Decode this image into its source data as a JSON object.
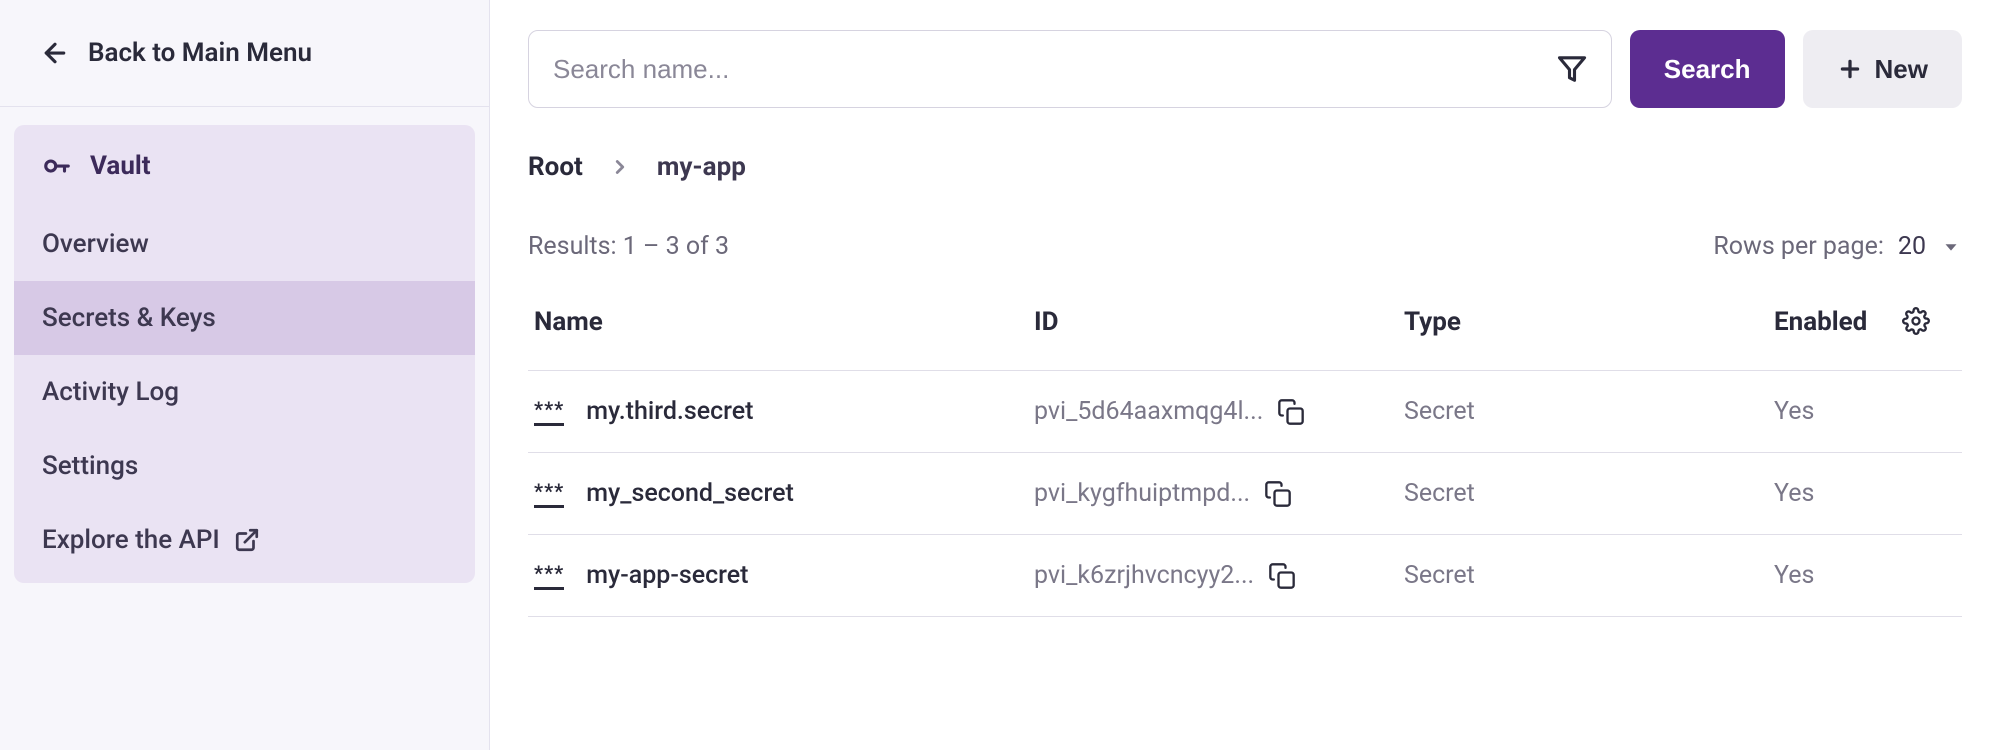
{
  "sidebar": {
    "back_label": "Back to Main Menu",
    "group_label": "Vault",
    "items": [
      {
        "label": "Overview"
      },
      {
        "label": "Secrets & Keys"
      },
      {
        "label": "Activity Log"
      },
      {
        "label": "Settings"
      },
      {
        "label": "Explore the API"
      }
    ]
  },
  "toolbar": {
    "search_placeholder": "Search name...",
    "search_label": "Search",
    "new_label": "New"
  },
  "breadcrumb": {
    "root": "Root",
    "current": "my-app"
  },
  "results_text": "Results: 1 – 3 of 3",
  "rows_per_page": {
    "label": "Rows per page:",
    "value": "20"
  },
  "table": {
    "headers": {
      "name": "Name",
      "id": "ID",
      "type": "Type",
      "enabled": "Enabled"
    },
    "rows": [
      {
        "name": "my.third.secret",
        "id": "pvi_5d64aaxmqg4l...",
        "type": "Secret",
        "enabled": "Yes"
      },
      {
        "name": "my_second_secret",
        "id": "pvi_kygfhuiptmpd...",
        "type": "Secret",
        "enabled": "Yes"
      },
      {
        "name": "my-app-secret",
        "id": "pvi_k6zrjhvcncyy2...",
        "type": "Secret",
        "enabled": "Yes"
      }
    ]
  }
}
